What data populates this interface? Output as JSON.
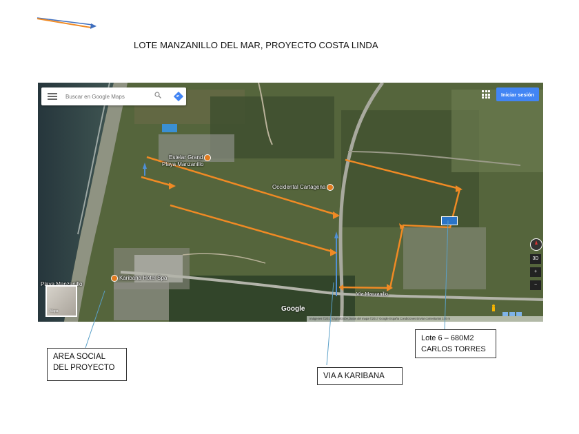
{
  "document": {
    "title": "LOTE MANZANILLO DEL MAR, PROYECTO COSTA LINDA"
  },
  "map_ui": {
    "search_placeholder": "Buscar en Google Maps",
    "signin_label": "Iniciar sesión",
    "satellite_thumb_label": "Mapa",
    "google_logo": "Google",
    "footer_text": "Imágenes ©2017 DigitalGlobe,Datos del mapa ©2017 Google    España    Condiciones    Enviar comentarios    100 m",
    "control_3d": "3D",
    "control_zoom_in": "+",
    "control_zoom_out": "−",
    "icons": [
      "menu-icon",
      "search-icon",
      "directions-icon",
      "apps-icon",
      "compass-icon",
      "pegman-icon"
    ]
  },
  "places": {
    "estelar": "Estelar Grand Playa Manzanillo",
    "estelar_line1": "Estelar Grand",
    "estelar_line2": "Playa Manzanillo",
    "occidental": "Occidental Cartagena",
    "karibana": "Karibana Hotel Spa",
    "playa": "Playa Manzanillo",
    "via_manzanillo": "Vía Manzanillo"
  },
  "callouts": {
    "area_social_line1": "AREA SOCIAL",
    "area_social_line2": "DEL PROYECTO",
    "via_karibana": "VIA A KARIBANA",
    "lote_line1": "Lote 6 – 680M2",
    "lote_line2": "CARLOS TORRES"
  },
  "colors": {
    "route": "#f08a24",
    "blue_line": "#4f8fd6",
    "signin": "#4285f4",
    "ocean": "#2a3a3e"
  }
}
